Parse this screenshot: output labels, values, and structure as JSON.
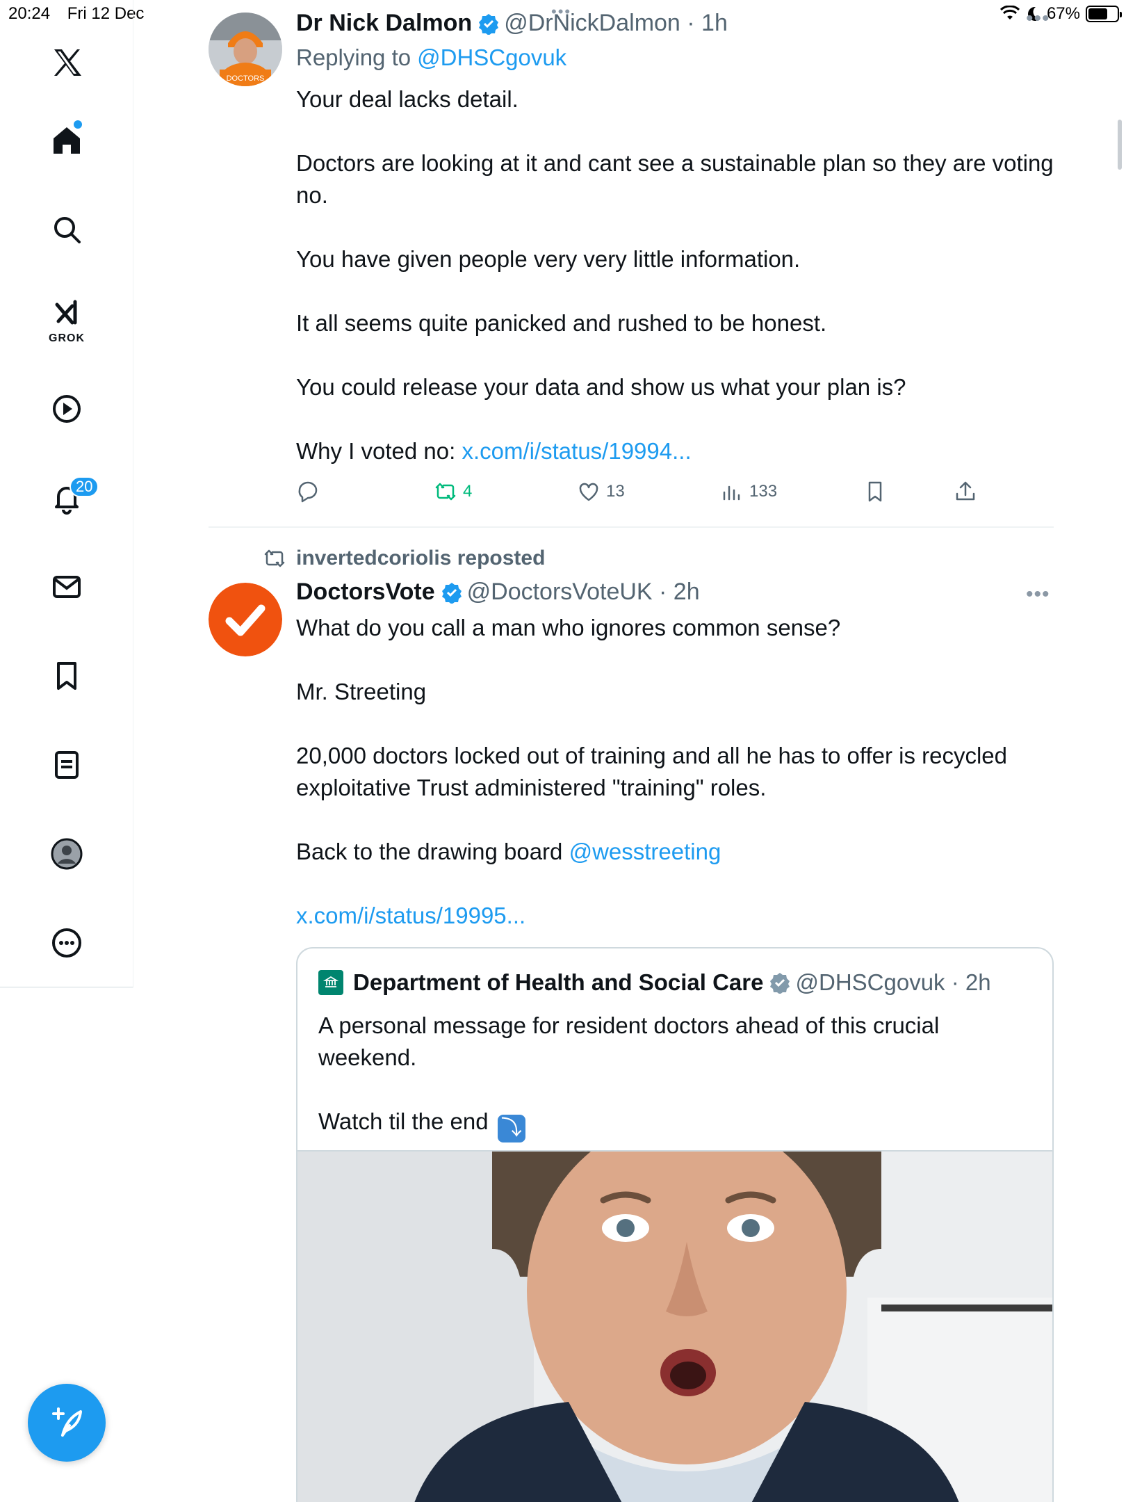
{
  "status_bar": {
    "time": "20:24",
    "date": "Fri 12 Dec",
    "battery": "67%",
    "battery_level": 0.67
  },
  "sidebar": {
    "items": [
      {
        "name": "x-logo-icon"
      },
      {
        "name": "home-icon"
      },
      {
        "name": "search-icon"
      },
      {
        "name": "grok-icon",
        "label": "GROK"
      },
      {
        "name": "video-icon"
      },
      {
        "name": "notifications-icon",
        "badge": "20"
      },
      {
        "name": "messages-icon"
      },
      {
        "name": "bookmarks-icon"
      },
      {
        "name": "lists-icon"
      },
      {
        "name": "profile-icon"
      },
      {
        "name": "more-icon"
      }
    ],
    "grok_label": "GROK",
    "notif_badge": "20",
    "accent": "#1d9bf0"
  },
  "tweet1": {
    "name": "Dr Nick Dalmon",
    "handle": "@DrNickDalmon · 1h",
    "replying_prefix": "Replying to ",
    "replying_to": "@DHSCgovuk",
    "paragraphs": [
      "Your deal lacks detail.",
      "Doctors are looking at it and cant see a sustainable plan so they are voting no.",
      "You have given people very very little information.",
      "It all seems quite panicked and rushed to be honest.",
      "You could release your data and show us what your plan is?"
    ],
    "last_prefix": "Why I voted no: ",
    "last_link": "x.com/i/status/19994...",
    "stats": {
      "reposts": "4",
      "likes": "13",
      "views": "133"
    },
    "avatar_text": "DOCTORS"
  },
  "tweet2": {
    "repost_by": "invertedcoriolis reposted",
    "name": "DoctorsVote",
    "handle": "@DoctorsVoteUK · 2h",
    "paragraphs": [
      "What do you call a man who ignores common sense?",
      "Mr. Streeting",
      "20,000 doctors locked out of training and all he has to offer is recycled exploitative Trust administered \"training\" roles."
    ],
    "back_prefix": "Back to the drawing board ",
    "mention": "@wesstreeting",
    "link": "x.com/i/status/19995...",
    "avatar_color": "#f0520f",
    "quote": {
      "name": "Department of Health and Social Care",
      "handle": "@DHSCgovuk · 2h",
      "paragraphs": [
        "A personal message for resident doctors ahead of this crucial weekend."
      ],
      "last_text": "Watch til the end",
      "emoji": "⤵"
    }
  }
}
